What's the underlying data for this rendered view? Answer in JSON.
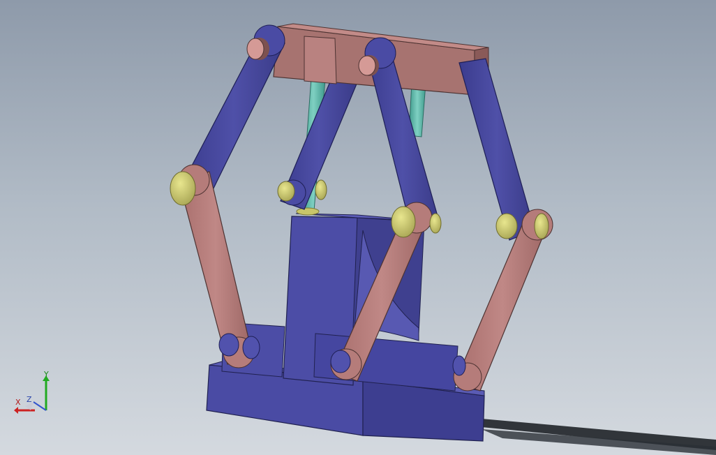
{
  "viewport": {
    "background_top": "#8e9aaa",
    "background_bottom": "#d4d9df"
  },
  "model": {
    "colors": {
      "blue_link": "#4a4aa0",
      "blue_dark": "#2e2f78",
      "pink_link": "#b57c7a",
      "pink_dark": "#7a5150",
      "pin_yellow": "#c8c66a",
      "rod_teal": "#5fb6a8",
      "shadow": "#1f2328"
    }
  },
  "triad": {
    "labels": {
      "x": "X",
      "y": "Y",
      "z": "Z"
    },
    "colors": {
      "x": "#cc2222",
      "y": "#22aa22",
      "z": "#3355cc"
    }
  }
}
